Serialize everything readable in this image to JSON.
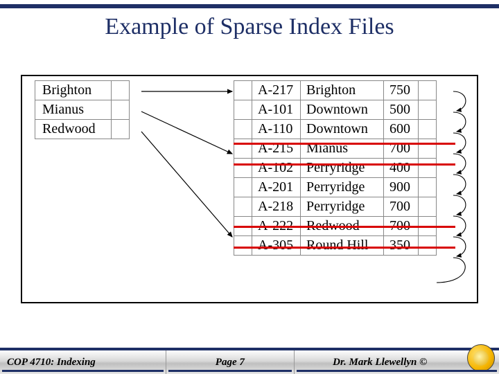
{
  "title": "Example of Sparse Index Files",
  "index_rows": [
    {
      "label": "Brighton"
    },
    {
      "label": "Mianus"
    },
    {
      "label": "Redwood"
    }
  ],
  "data_rows": [
    {
      "id": "A-217",
      "city": "Brighton",
      "val": "750"
    },
    {
      "id": "A-101",
      "city": "Downtown",
      "val": "500"
    },
    {
      "id": "A-110",
      "city": "Downtown",
      "val": "600"
    },
    {
      "id": "A-215",
      "city": "Mianus",
      "val": "700"
    },
    {
      "id": "A-102",
      "city": "Perryridge",
      "val": "400"
    },
    {
      "id": "A-201",
      "city": "Perryridge",
      "val": "900"
    },
    {
      "id": "A-218",
      "city": "Perryridge",
      "val": "700"
    },
    {
      "id": "A-222",
      "city": "Redwood",
      "val": "700"
    },
    {
      "id": "A-305",
      "city": "Round Hill",
      "val": "350"
    }
  ],
  "red_dividers_after_row_index": [
    2,
    3,
    6,
    7
  ],
  "footer": {
    "left": "COP 4710: Indexing",
    "mid": "Page 7",
    "right": "Dr. Mark Llewellyn ©"
  }
}
